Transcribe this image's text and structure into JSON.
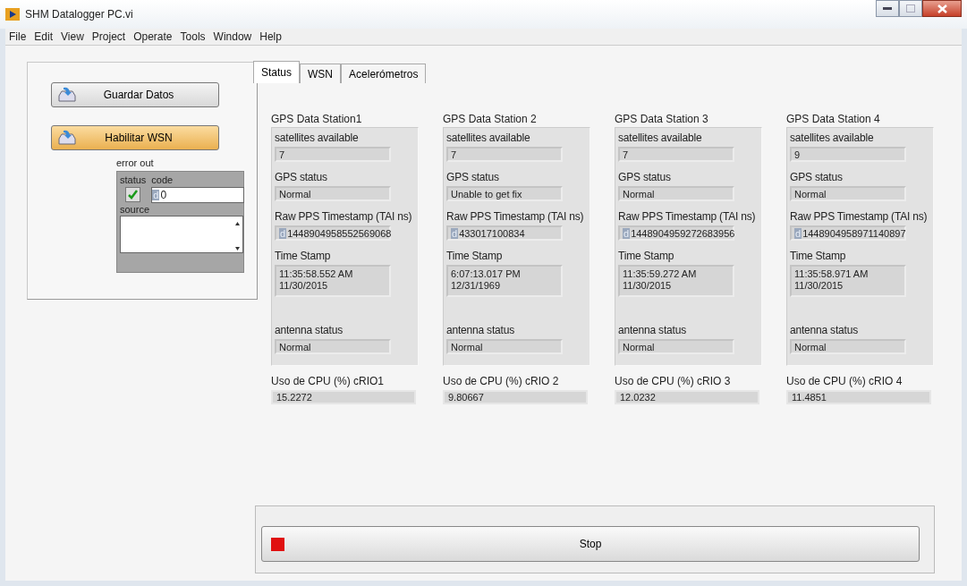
{
  "window": {
    "title": "SHM Datalogger PC.vi"
  },
  "menu": [
    "File",
    "Edit",
    "View",
    "Project",
    "Operate",
    "Tools",
    "Window",
    "Help"
  ],
  "buttons": [
    {
      "label": "Guardar Datos",
      "on": false
    },
    {
      "label": "Habilitar WSN",
      "on": true
    }
  ],
  "error_out": {
    "label": "error out",
    "status_label": "status",
    "status_ok": true,
    "code_label": "code",
    "code_radix": "d",
    "code": "0",
    "source_label": "source"
  },
  "tabs": [
    {
      "label": "Status",
      "selected": true
    },
    {
      "label": "WSN",
      "selected": false
    },
    {
      "label": "Acelerómetros",
      "selected": false
    }
  ],
  "stations": [
    {
      "title": "GPS Data Station1",
      "fields": [
        {
          "label": "satellites available",
          "value": "7"
        },
        {
          "label": "GPS status",
          "value": "Normal"
        },
        {
          "label": "Raw PPS Timestamp (TAI ns)",
          "radix": "d",
          "value": "1448904958552569068"
        },
        {
          "label": "Time Stamp",
          "value": "11:35:58.552 AM\n11/30/2015",
          "kind": "tall"
        },
        {
          "label": "antenna status",
          "value": "Normal"
        }
      ],
      "cpu_label": "Uso de CPU (%) cRIO1",
      "cpu": "15.2272"
    },
    {
      "title": "GPS Data Station 2",
      "fields": [
        {
          "label": "satellites available",
          "value": "7"
        },
        {
          "label": "GPS status",
          "value": "Unable to get fix"
        },
        {
          "label": "Raw PPS Timestamp (TAI ns)",
          "radix": "d",
          "value": "433017100834"
        },
        {
          "label": "Time Stamp",
          "value": "6:07:13.017 PM\n12/31/1969",
          "kind": "tall"
        },
        {
          "label": "antenna status",
          "value": "Normal"
        }
      ],
      "cpu_label": "Uso de CPU (%) cRIO 2",
      "cpu": "9.80667"
    },
    {
      "title": "GPS Data Station 3",
      "fields": [
        {
          "label": "satellites available",
          "value": "7"
        },
        {
          "label": "GPS status",
          "value": "Normal"
        },
        {
          "label": "Raw PPS Timestamp (TAI ns)",
          "radix": "d",
          "value": "1448904959272683956"
        },
        {
          "label": "Time Stamp",
          "value": "11:35:59.272 AM\n11/30/2015",
          "kind": "tall"
        },
        {
          "label": "antenna status",
          "value": "Normal"
        }
      ],
      "cpu_label": "Uso de CPU (%) cRIO 3",
      "cpu": "12.0232"
    },
    {
      "title": "GPS Data Station 4",
      "fields": [
        {
          "label": "satellites available",
          "value": "9"
        },
        {
          "label": "GPS status",
          "value": "Normal"
        },
        {
          "label": "Raw PPS Timestamp (TAI ns)",
          "radix": "d",
          "value": "1448904958971140897"
        },
        {
          "label": "Time Stamp",
          "value": "11:35:58.971 AM\n11/30/2015",
          "kind": "tall"
        },
        {
          "label": "antenna status",
          "value": "Normal"
        }
      ],
      "cpu_label": "Uso de CPU (%) cRIO 4",
      "cpu": "11.4851"
    }
  ],
  "stop": {
    "label": "Stop"
  }
}
